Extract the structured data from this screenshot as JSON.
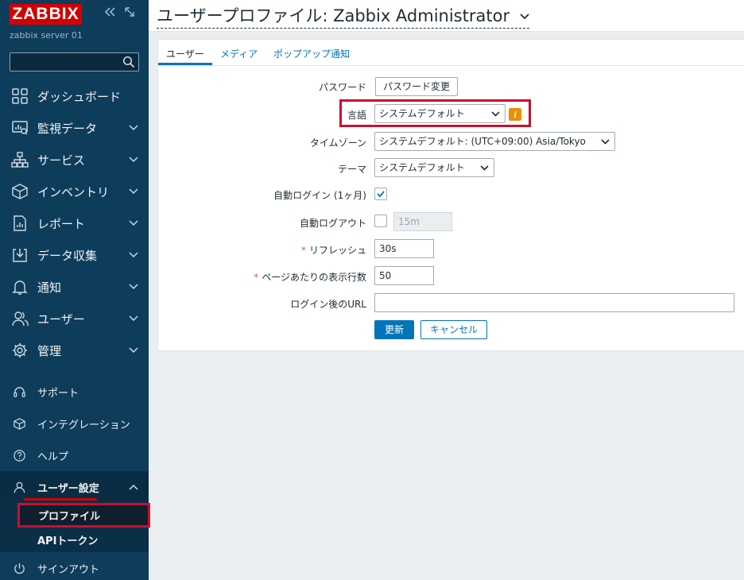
{
  "sidebar": {
    "logo": "ZABBIX",
    "server_name": "zabbix server 01",
    "search_placeholder": "",
    "menu": [
      {
        "label": "ダッシュボード",
        "icon": "dashboard-icon"
      },
      {
        "label": "監視データ",
        "icon": "monitoring-icon"
      },
      {
        "label": "サービス",
        "icon": "services-icon"
      },
      {
        "label": "インベントリ",
        "icon": "inventory-icon"
      },
      {
        "label": "レポート",
        "icon": "reports-icon"
      },
      {
        "label": "データ収集",
        "icon": "data-collection-icon"
      },
      {
        "label": "通知",
        "icon": "bell-icon"
      },
      {
        "label": "ユーザー",
        "icon": "users-icon"
      },
      {
        "label": "管理",
        "icon": "gear-icon"
      }
    ],
    "bottom_menu": [
      {
        "label": "サポート",
        "icon": "headset-icon"
      },
      {
        "label": "インテグレーション",
        "icon": "cube-icon"
      },
      {
        "label": "ヘルプ",
        "icon": "help-icon"
      },
      {
        "label": "ユーザー設定",
        "icon": "user-icon"
      }
    ],
    "user_settings_sub": [
      {
        "label": "プロファイル"
      },
      {
        "label": "APIトークン"
      }
    ],
    "signout": "サインアウト"
  },
  "header": {
    "title": "ユーザープロファイル: Zabbix Administrator"
  },
  "tabs": [
    {
      "label": "ユーザー"
    },
    {
      "label": "メディア"
    },
    {
      "label": "ポップアップ通知"
    }
  ],
  "form": {
    "password_label": "パスワード",
    "password_button": "パスワード変更",
    "language_label": "言語",
    "language_value": "システムデフォルト",
    "timezone_label": "タイムゾーン",
    "timezone_value": "システムデフォルト: (UTC+09:00) Asia/Tokyo",
    "theme_label": "テーマ",
    "theme_value": "システムデフォルト",
    "autologin_label": "自動ログイン (1ヶ月)",
    "autologout_label": "自動ログアウト",
    "autologout_value": "15m",
    "refresh_label": "リフレッシュ",
    "refresh_value": "30s",
    "rows_label": "ページあたりの表示行数",
    "rows_value": "50",
    "url_label": "ログイン後のURL",
    "url_value": "",
    "required_mark": "*",
    "info_mark": "i",
    "update_button": "更新",
    "cancel_button": "キャンセル"
  }
}
